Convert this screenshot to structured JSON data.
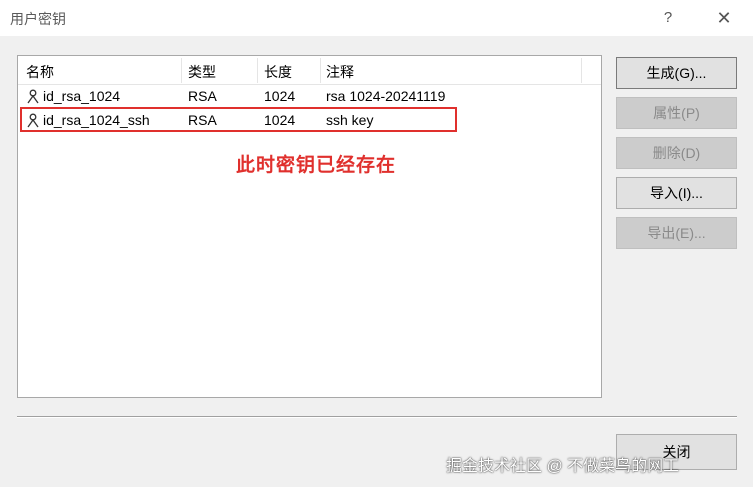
{
  "window": {
    "title": "用户密钥",
    "help_glyph": "?",
    "close_glyph": "✕"
  },
  "table": {
    "headers": [
      "名称",
      "类型",
      "长度",
      "注释"
    ],
    "rows": [
      {
        "name": "id_rsa_1024",
        "type": "RSA",
        "length": "1024",
        "comment": "rsa 1024-20241119"
      },
      {
        "name": "id_rsa_1024_ssh",
        "type": "RSA",
        "length": "1024",
        "comment": "ssh key"
      }
    ]
  },
  "annotation": "此时密钥已经存在",
  "buttons": {
    "generate": "生成(G)...",
    "properties": "属性(P)",
    "delete": "删除(D)",
    "import": "导入(I)...",
    "export": "导出(E)...",
    "close": "关闭"
  },
  "watermark": "掘金技术社区 @ 不做菜鸟的网工",
  "colors": {
    "annotation_red": "#e0302d",
    "dialog_bg": "#f0f0f0",
    "button_bg": "#e1e1e1"
  }
}
